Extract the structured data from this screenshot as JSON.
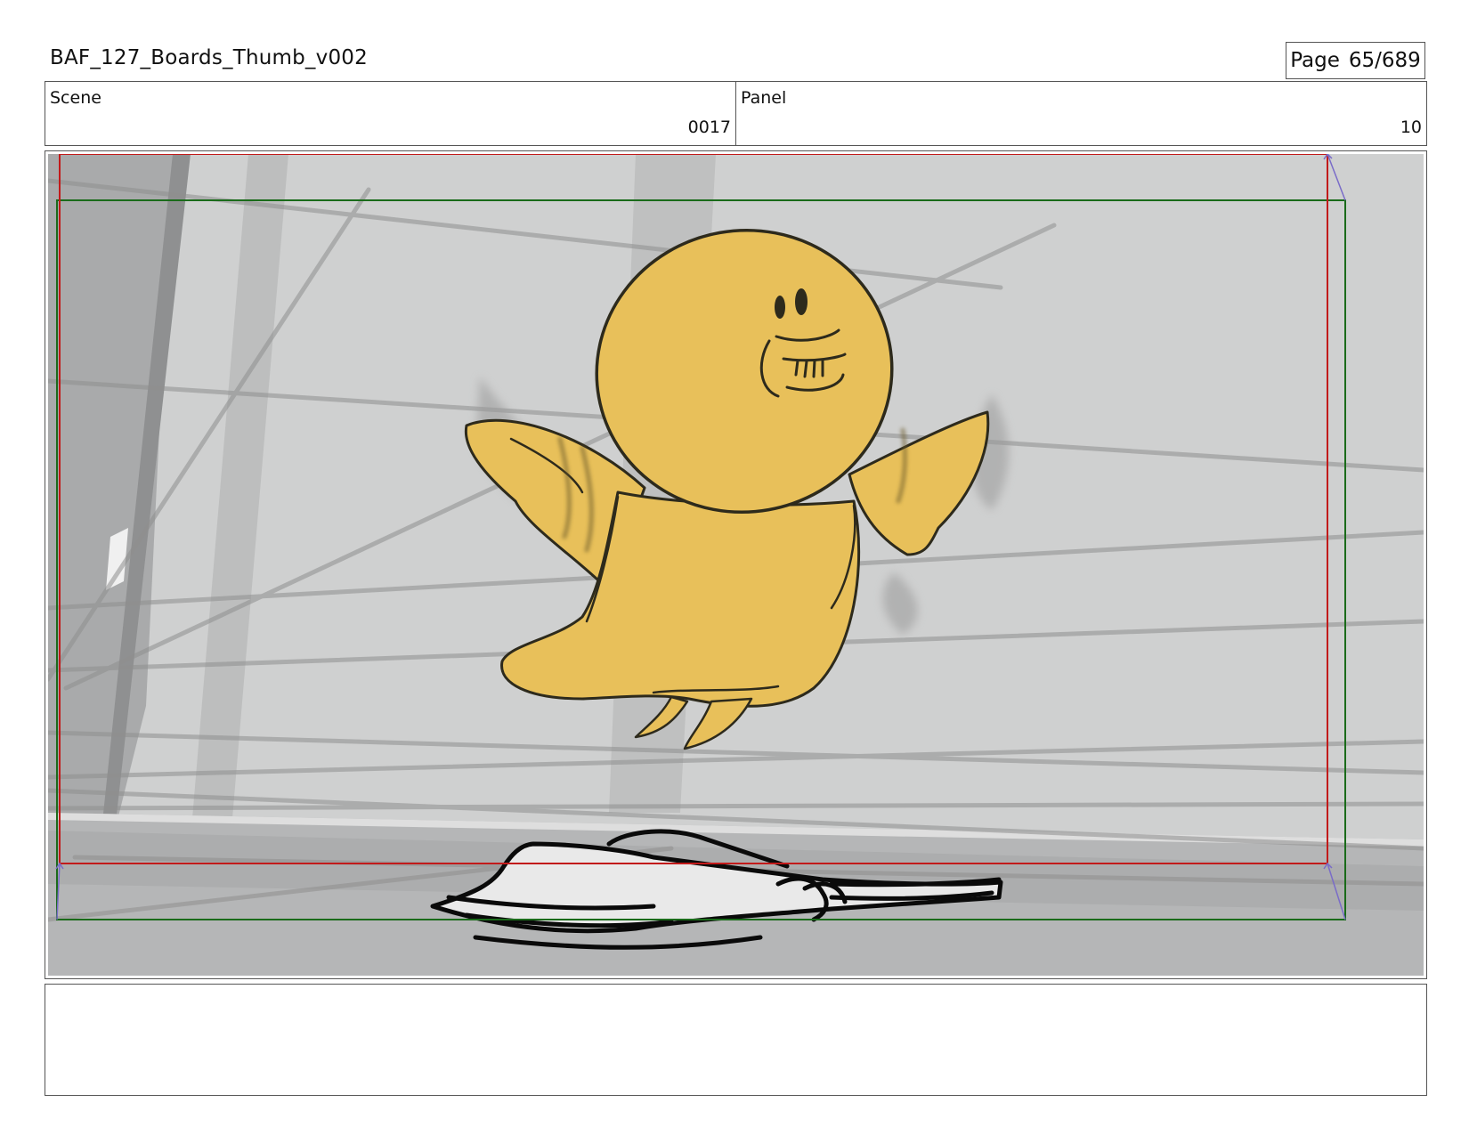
{
  "header": {
    "title": "BAF_127_Boards_Thumb_v002",
    "page_label": "Page",
    "page_value": "65/689"
  },
  "scene": {
    "label": "Scene",
    "value": "0017"
  },
  "panel": {
    "label": "Panel",
    "value": "10"
  },
  "notes": {
    "text": ""
  },
  "colors": {
    "safe_frame": "#c21a1a",
    "action_frame": "#1a6b1a",
    "character_fill": "#e8c05a",
    "background_gray": "#cfd0d0"
  }
}
